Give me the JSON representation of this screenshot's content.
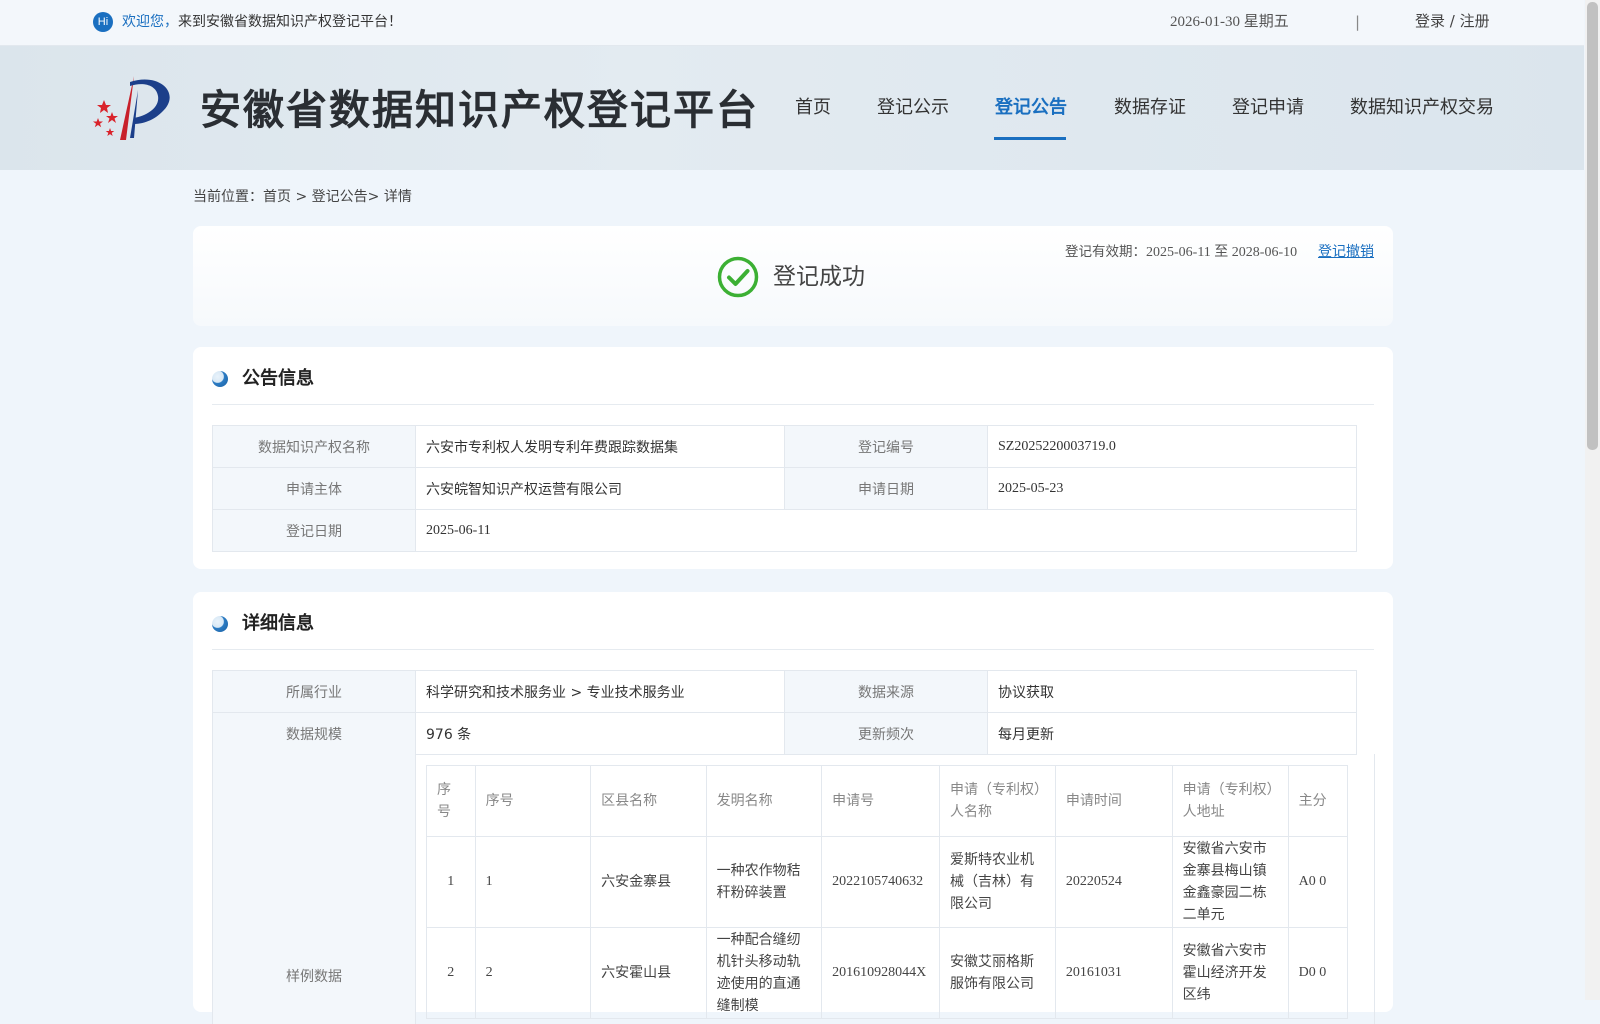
{
  "topbar": {
    "hi": "Hi",
    "welcome_highlight": "欢迎您，",
    "welcome_rest": "来到安徽省数据知识产权登记平台！",
    "date": "2026-01-30 星期五",
    "divider": "|",
    "login": "登录",
    "slash": " / ",
    "register": "注册"
  },
  "header": {
    "logo_text": "安徽省数据知识产权登记平台",
    "nav": [
      {
        "label": "首页"
      },
      {
        "label": "登记公示"
      },
      {
        "label": "登记公告",
        "active": true
      },
      {
        "label": "数据存证"
      },
      {
        "label": "登记申请"
      },
      {
        "label": "数据知识产权交易"
      }
    ]
  },
  "breadcrumb": {
    "prefix": "当前位置：",
    "home": "首页",
    "sep1": " > ",
    "section": "登记公告",
    "sep2": "> ",
    "current": "详情"
  },
  "status": {
    "text": "登记成功",
    "validity_label": "登记有效期：",
    "validity_value": "2025-06-11 至 2028-06-10",
    "revoke": "登记撤销",
    "success_color": "#3cb034"
  },
  "notice": {
    "title": "公告信息",
    "rows": [
      {
        "k1": "数据知识产权名称",
        "v1": "六安市专利权人发明专利年费跟踪数据集",
        "k2": "登记编号",
        "v2": "SZ2025220003719.0"
      },
      {
        "k1": "申请主体",
        "v1": "六安皖智知识产权运营有限公司",
        "k2": "申请日期",
        "v2": "2025-05-23"
      },
      {
        "k1": "登记日期",
        "v1": "2025-06-11"
      }
    ]
  },
  "detail": {
    "title": "详细信息",
    "rows": [
      {
        "k1": "所属行业",
        "v1": "科学研究和技术服务业 > 专业技术服务业",
        "k2": "数据来源",
        "v2": "协议获取"
      },
      {
        "k1": "数据规模",
        "v1": "976 条",
        "k2": "更新频次",
        "v2": "每月更新"
      }
    ],
    "sample_label": "样例数据",
    "sample_headers": [
      "序号",
      "序号",
      "区县名称",
      "发明名称",
      "申请号",
      "申请（专利权）人名称",
      "申请时间",
      "申请（专利权）人地址",
      "主分"
    ],
    "sample_rows": [
      [
        "1",
        "1",
        "六安金寨县",
        "一种农作物秸秆粉碎装置",
        "2022105740632",
        "爱斯特农业机械（吉林）有限公司",
        "20220524",
        "安徽省六安市金寨县梅山镇金鑫豪园二栋二单元",
        "A0 0"
      ],
      [
        "2",
        "2",
        "六安霍山县",
        "一种配合缝纫机针头移动轨迹使用的直通缝制模",
        "201610928044X",
        "安徽艾丽格斯服饰有限公司",
        "20161031",
        "安徽省六安市霍山经济开发区纬",
        "D0 0"
      ]
    ]
  },
  "colors": {
    "accent": "#1a6fc0",
    "page_bg": "#eff5fb"
  }
}
